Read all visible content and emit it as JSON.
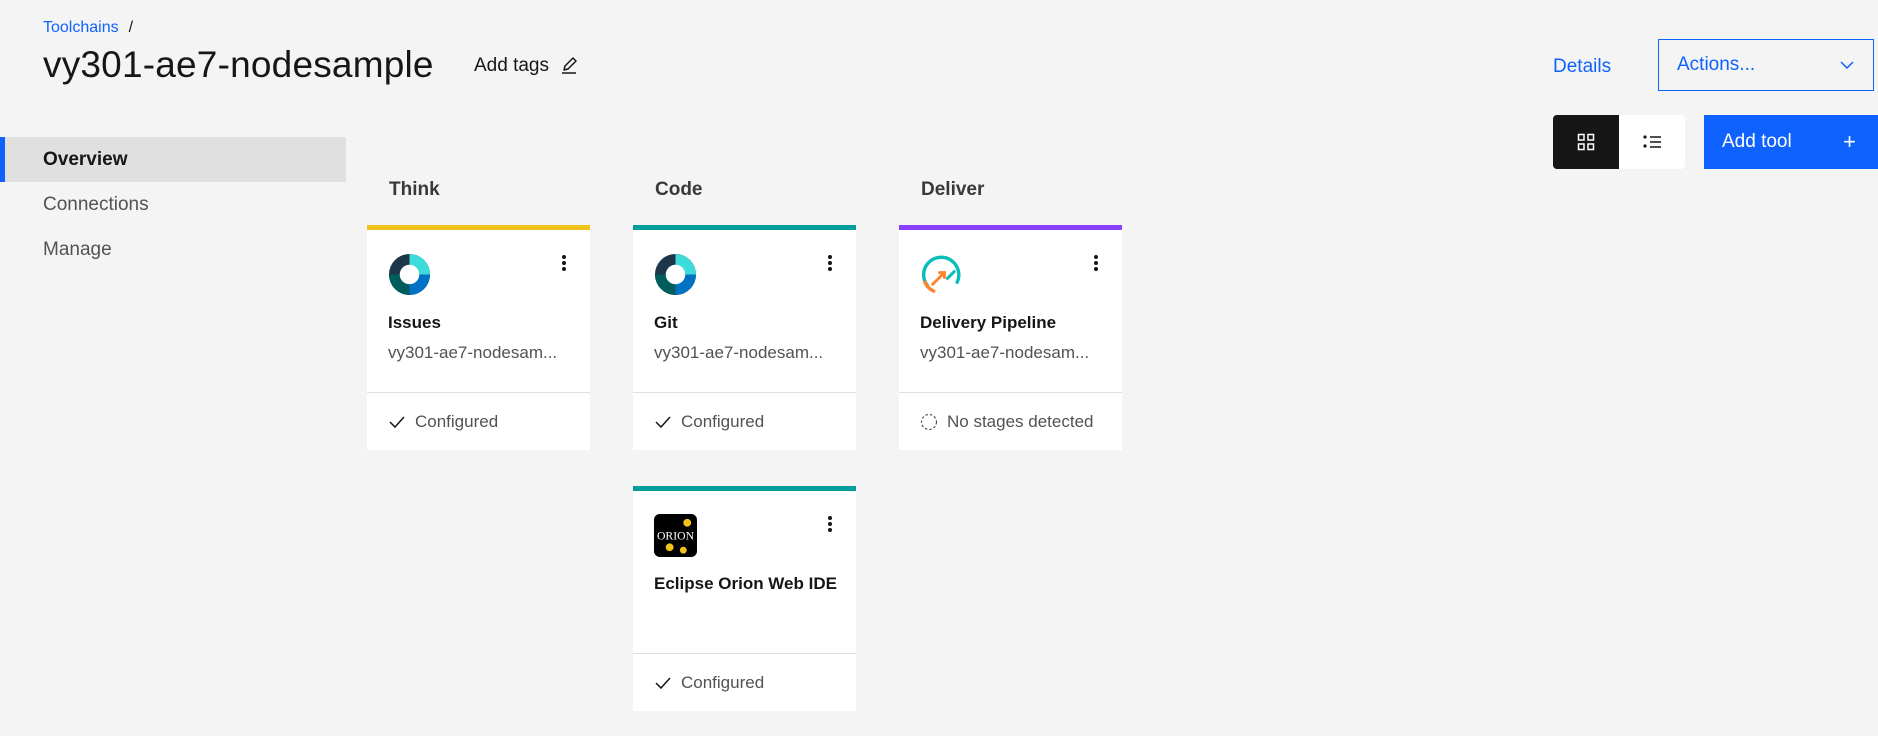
{
  "breadcrumb": {
    "root": "Toolchains",
    "separator": "/"
  },
  "header": {
    "title": "vy301-ae7-nodesample",
    "add_tags_label": "Add tags",
    "details_label": "Details",
    "actions_label": "Actions..."
  },
  "sidebar": {
    "items": [
      {
        "label": "Overview",
        "active": true
      },
      {
        "label": "Connections",
        "active": false
      },
      {
        "label": "Manage",
        "active": false
      }
    ]
  },
  "toolbar": {
    "view_grid_icon": "grid-view-icon",
    "view_list_icon": "list-view-icon",
    "add_tool_label": "Add tool",
    "add_tool_icon": "+"
  },
  "columns": [
    {
      "name": "Think",
      "color": "#f1c21b"
    },
    {
      "name": "Code",
      "color": "#009d9a"
    },
    {
      "name": "Deliver",
      "color": "#8a3ffc"
    }
  ],
  "cards": [
    {
      "column": "Think",
      "name": "Issues",
      "subtitle": "vy301-ae7-nodesam...",
      "status": "Configured",
      "status_icon": "checkmark-icon",
      "icon": "issues-tool-icon"
    },
    {
      "column": "Code",
      "name": "Git",
      "subtitle": "vy301-ae7-nodesam...",
      "status": "Configured",
      "status_icon": "checkmark-icon",
      "icon": "git-tool-icon"
    },
    {
      "column": "Deliver",
      "name": "Delivery Pipeline",
      "subtitle": "vy301-ae7-nodesam...",
      "status": "No stages detected",
      "status_icon": "dashed-circle-icon",
      "icon": "delivery-pipeline-icon"
    },
    {
      "column": "Code",
      "name": "Eclipse Orion Web IDE",
      "subtitle": "",
      "status": "Configured",
      "status_icon": "checkmark-icon",
      "icon": "orion-ide-icon",
      "icon_text": "ORION"
    }
  ],
  "colors": {
    "accent": "#0f62fe",
    "background": "#f4f4f4",
    "think": "#f1c21b",
    "code": "#009d9a",
    "deliver": "#8a3ffc"
  }
}
